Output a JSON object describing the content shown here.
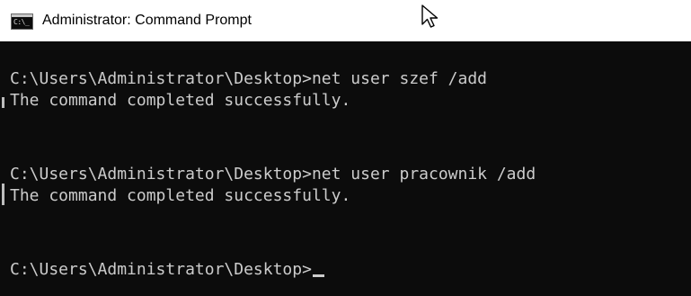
{
  "window": {
    "title": "Administrator: Command Prompt",
    "icon": "cmd-console-icon",
    "icon_label": "C:\\_"
  },
  "console": {
    "lines": [
      "C:\\Users\\Administrator\\Desktop>net user szef /add",
      "The command completed successfully.",
      "C:\\Users\\Administrator\\Desktop>net user pracownik /add",
      "The command completed successfully.",
      "C:\\Users\\Administrator\\Desktop>"
    ],
    "text_color": "#cccccc",
    "background_color": "#0c0c0c"
  }
}
